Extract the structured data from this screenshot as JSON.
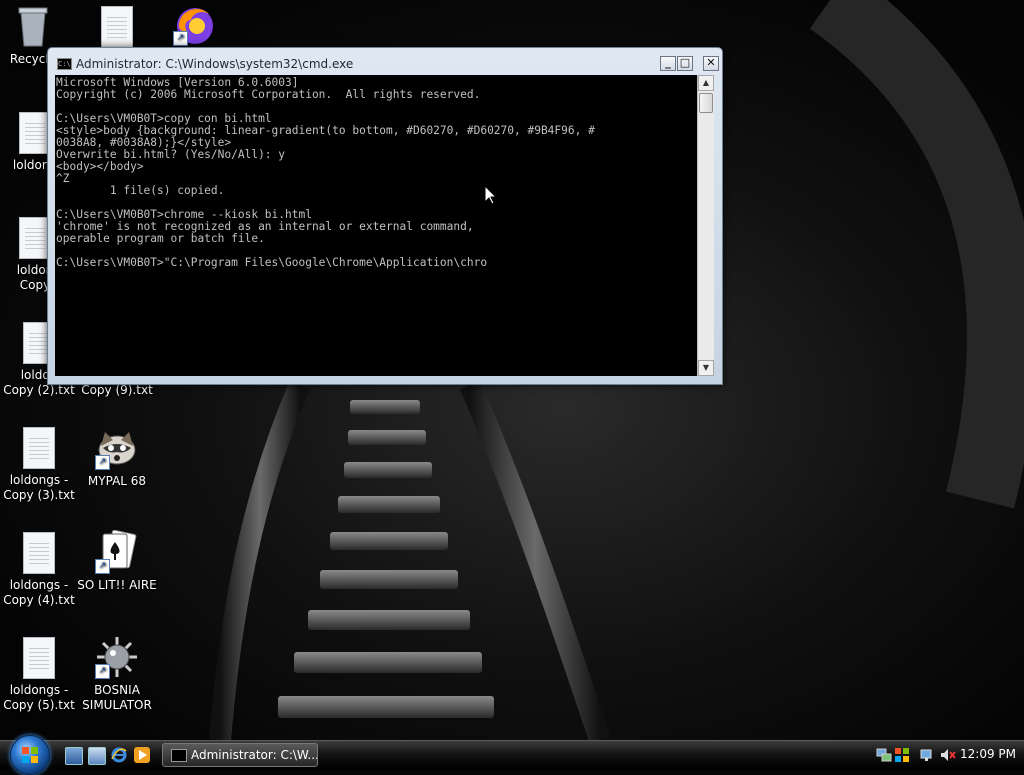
{
  "desktop": {
    "icons": [
      {
        "label": "Recycle",
        "kind": "recycle-bin"
      },
      {
        "label": "",
        "kind": "document"
      },
      {
        "label": "",
        "kind": "firefox"
      },
      {
        "label": "loldong",
        "kind": "document"
      },
      {
        "label": "loldon",
        "label2": "Copy",
        "kind": "document"
      },
      {
        "label": "loldon",
        "label2": "Copy (2).txt",
        "kind": "document"
      },
      {
        "label": "Copy (9).txt",
        "kind": "document"
      },
      {
        "label": "loldongs -",
        "label2": "Copy (3).txt",
        "kind": "document"
      },
      {
        "label": "MYPAL 68",
        "kind": "mypal"
      },
      {
        "label": "loldongs -",
        "label2": "Copy (4).txt",
        "kind": "document"
      },
      {
        "label": "SO LIT!! AIRE",
        "kind": "solitaire"
      },
      {
        "label": "loldongs -",
        "label2": "Copy (5).txt",
        "kind": "document"
      },
      {
        "label": "BOSNIA",
        "label2": "SIMULATOR",
        "kind": "bosnia"
      }
    ]
  },
  "window": {
    "title": "Administrator: C:\\Windows\\system32\\cmd.exe",
    "buttons": {
      "minimize": "_",
      "maximize": "□",
      "close": "✕"
    },
    "console_text": "Microsoft Windows [Version 6.0.6003]\nCopyright (c) 2006 Microsoft Corporation.  All rights reserved.\n\nC:\\Users\\VM0B0T>copy con bi.html\n<style>body {background: linear-gradient(to bottom, #D60270, #D60270, #9B4F96, #\n0038A8, #0038A8);}</style>\nOverwrite bi.html? (Yes/No/All): y\n<body></body>\n^Z\n        1 file(s) copied.\n\nC:\\Users\\VM0B0T>chrome --kiosk bi.html\n'chrome' is not recognized as an internal or external command,\noperable program or batch file.\n\nC:\\Users\\VM0B0T>\"C:\\Program Files\\Google\\Chrome\\Application\\chro"
  },
  "taskbar": {
    "task_button_label": "Administrator: C:\\W...",
    "clock": "12:09 PM"
  },
  "colors": {
    "console_bg": "#000000",
    "console_fg": "#c0c0c0",
    "taskbar": "#141414",
    "start_orb": "#2f7ad1"
  }
}
